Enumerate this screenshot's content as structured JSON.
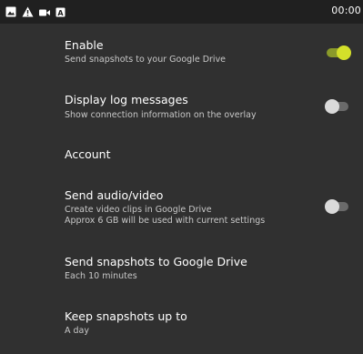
{
  "status_bar": {
    "time": "00:00",
    "icons": [
      "image-icon",
      "warning-icon",
      "video-icon",
      "notification-icon"
    ]
  },
  "settings": {
    "enable": {
      "title": "Enable",
      "subtitle": "Send snapshots to your Google Drive",
      "toggle_on": true
    },
    "display_log": {
      "title": "Display log messages",
      "subtitle": "Show connection information on the overlay",
      "toggle_on": false
    },
    "account": {
      "title": "Account"
    },
    "send_av": {
      "title": "Send audio/video",
      "subtitle_line1": "Create video clips in Google Drive",
      "subtitle_line2": "Approx 6 GB will be used with current settings",
      "toggle_on": false
    },
    "send_snapshots": {
      "title": "Send snapshots to Google Drive",
      "subtitle": "Each 10 minutes"
    },
    "keep_snapshots": {
      "title": "Keep snapshots up to",
      "subtitle": "A day"
    }
  },
  "colors": {
    "toggle_on_thumb": "#d4e02a",
    "toggle_on_track": "#8a9a2a",
    "toggle_off_thumb": "#dadada",
    "toggle_off_track": "#6a6a6a",
    "panel_background": "#303030",
    "status_bar_background": "#202020"
  }
}
